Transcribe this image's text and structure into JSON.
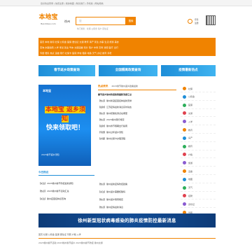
{
  "topbar": {
    "text": "您好欢迎登录 | 免费注册 | 我的收藏 | 联系我们 | 手机版 | 网站导航"
  },
  "logo": {
    "name": "本地宝",
    "domain": "Bendibao.com"
  },
  "search": {
    "city": "徐州",
    "placeholder": "搜",
    "button_label": "搜索",
    "hotwords": "热门搜索：社保 公积金 落户 居住证"
  },
  "user": {
    "line1": "登录",
    "line2": "注册"
  },
  "nav": {
    "row1": "首页 本地 新闻 社保 公积金 医保 居住证 交通 教育 房产 民生 办事 生活 旅游 美食",
    "row2": "查询 办事指南 入学 考试 就业 驾车 交通违章 积分 落户 中考 高考 消费 医疗 出行",
    "row3": "专题 便民 热点 违章 限行 社保卡 医院 学校 租房 地铁 天气 办证 婚育 养老"
  },
  "banners": [
    "春节返乡政策查询",
    "全国隔离政策查询",
    "疫情最新热点"
  ],
  "ad": {
    "top": "本地宝",
    "big1": "本地宝 返乡须知",
    "big2": "快来领取吧！",
    "bottom": "2023春节返乡须知"
  },
  "center": {
    "title": "热点资讯",
    "head": "2023春节徐州返乡政策最新",
    "lines": [
      "春节返乡徐州防控政策最新消息汇总",
      "【热点】徐州新冠疫苗接种最新安排",
      "【最新】江苏疫情最新消息实时动态",
      "【热点】徐州核酸检测点在哪里",
      "【热点】2023徐州限行规定",
      "【最新】徐州春节假期出行指南",
      "【专题】徐州过年返乡须知",
      "【办事】徐州社保卡办理流程"
    ],
    "list2_title": "今日热议",
    "list2": [
      "【关注】2023徐州春节防控最新通知",
      "【热点】2023徐州春节活动汇总",
      "【关注】徐州疫苗接种点查询"
    ],
    "list3": [
      "【热点】徐州最新疫情防控政策",
      "【关注】徐州返乡需要核酸吗",
      "【热点】徐州返乡隔离规定",
      "【热点】徐州疫情最新消息"
    ]
  },
  "side": [
    "社保",
    "公积金",
    "医保",
    "交通",
    "入学",
    "教育",
    "房产",
    "婚育",
    "户籍",
    "旅游",
    "违章",
    "地图",
    "天气",
    "招聘",
    "身份证",
    "驾照"
  ],
  "side_colors": [
    "#f08300",
    "#1e8ed8",
    "#2cae5a",
    "#e0414e",
    "#8a5bd1",
    "#f08300",
    "#1e8ed8",
    "#2cae5a",
    "#e0414e",
    "#8a5bd1",
    "#f08300",
    "#1e8ed8",
    "#2cae5a",
    "#e0414e",
    "#8a5bd1",
    "#f08300"
  ],
  "strip": "徐州新型冠状病毒感染的肺炎疫情防控最新消息",
  "tabs": "首页 社保 公积金 医保 居住证 驾照 户籍 入学",
  "footer": "2023徐州春节活动  2023徐州春节返乡  2023徐州春节防控  徐州交通"
}
